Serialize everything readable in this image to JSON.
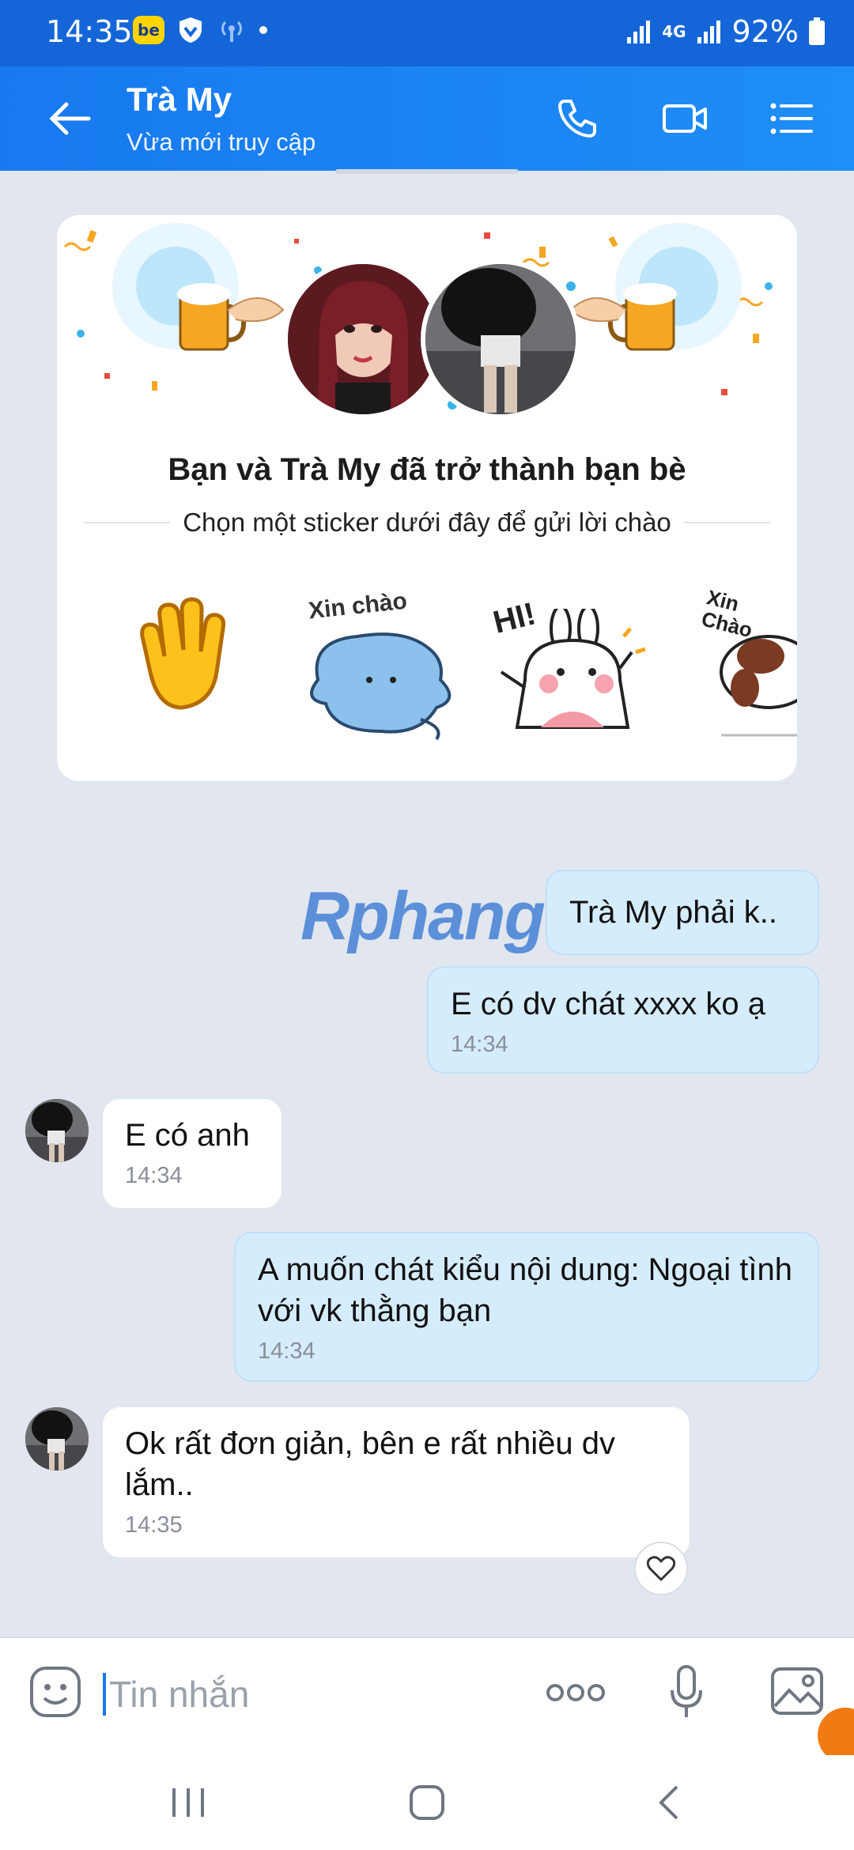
{
  "status_bar": {
    "time": "14:35",
    "app_badge": "be",
    "network": "4G",
    "battery": "92%"
  },
  "header": {
    "contact_name": "Trà My",
    "presence": "Vừa mới truy cập",
    "icons": [
      "back-arrow-icon",
      "phone-icon",
      "video-camera-icon",
      "menu-list-icon"
    ]
  },
  "friend_card": {
    "title": "Bạn và Trà My đã trở thành bạn bè",
    "subtitle": "Chọn một sticker dưới đây để gửi lời chào",
    "stickers": [
      {
        "name": "waving-hand-sticker"
      },
      {
        "name": "cat-xin-chao-sticker",
        "text": "Xin chào"
      },
      {
        "name": "bunny-hi-sticker",
        "text": "HI!"
      },
      {
        "name": "dog-xin-chao-sticker",
        "text": "Xin Chào"
      }
    ]
  },
  "watermark": "Rphang",
  "messages": [
    {
      "direction": "out",
      "text": "Trà My phải k..",
      "time": ""
    },
    {
      "direction": "out",
      "text": "E có dv chát xxxx ko ạ",
      "time": "14:34"
    },
    {
      "direction": "in",
      "text": "E có anh",
      "time": "14:34"
    },
    {
      "direction": "out",
      "text": "A muốn chát kiểu nội dung: Ngoại tình với vk thằng bạn",
      "time": "14:34"
    },
    {
      "direction": "in",
      "text": "Ok rất đơn giản, bên e rất nhiều dv lắm..",
      "time": "14:35"
    }
  ],
  "composer": {
    "placeholder": "Tin nhắn",
    "icons": [
      "sticker-icon",
      "more-dots-icon",
      "microphone-icon",
      "image-icon"
    ]
  },
  "colors": {
    "header_blue": "#1f8ef6",
    "outgoing_bubble": "#d5ecfd",
    "background": "#e2e6ee"
  }
}
